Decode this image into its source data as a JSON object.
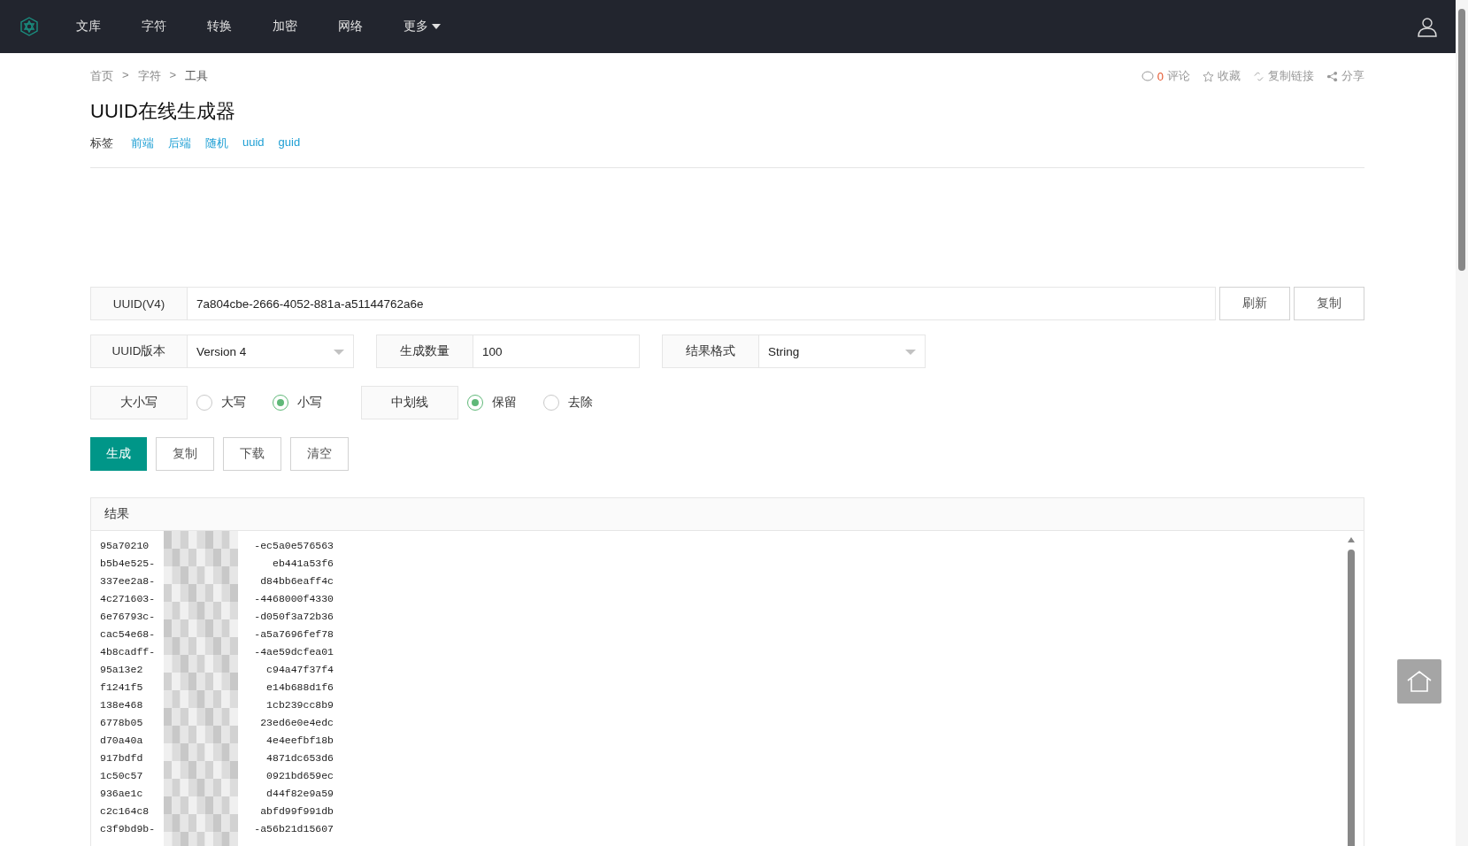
{
  "nav": {
    "items": [
      "文库",
      "字符",
      "转换",
      "加密",
      "网络"
    ],
    "more": "更多"
  },
  "breadcrumb": [
    "首页",
    "字符",
    "工具"
  ],
  "breadcrumb_separator": ">",
  "title": "UUID在线生成器",
  "tags": {
    "label": "标签",
    "items": [
      "前端",
      "后端",
      "随机",
      "uuid",
      "guid"
    ]
  },
  "actions": {
    "comment_count": "0",
    "comment": "评论",
    "favorite": "收藏",
    "copy_link": "复制链接",
    "share": "分享"
  },
  "uuid_row": {
    "label": "UUID(V4)",
    "value": "7a804cbe-2666-4052-881a-a51144762a6e",
    "buttons": [
      "刷新",
      "复制"
    ]
  },
  "settings": [
    {
      "label": "UUID版本",
      "value": "Version 4",
      "kind": "select"
    },
    {
      "label": "生成数量",
      "value": "100",
      "kind": "input"
    },
    {
      "label": "结果格式",
      "value": "String",
      "kind": "select"
    }
  ],
  "radio_groups": [
    {
      "label": "大小写",
      "options": [
        {
          "label": "大写",
          "selected": false
        },
        {
          "label": "小写",
          "selected": true
        }
      ]
    },
    {
      "label": "中划线",
      "options": [
        {
          "label": "保留",
          "selected": true
        },
        {
          "label": "去除",
          "selected": false
        }
      ]
    }
  ],
  "buttons": [
    {
      "label": "生成",
      "kind": "primary"
    },
    {
      "label": "复制",
      "kind": "default"
    },
    {
      "label": "下载",
      "kind": "default"
    },
    {
      "label": "清空",
      "kind": "default"
    }
  ],
  "results": {
    "title": "结果",
    "lines": [
      {
        "head": "95a70210",
        "tail": "-ec5a0e576563"
      },
      {
        "head": "b5b4e525-",
        "tail": "eb441a53f6"
      },
      {
        "head": "337ee2a8-",
        "tail": "d84bb6eaff4c"
      },
      {
        "head": "4c271603-",
        "tail": "-4468000f4330"
      },
      {
        "head": "6e76793c-",
        "tail": "-d050f3a72b36"
      },
      {
        "head": "cac54e68-",
        "tail": "-a5a7696fef78"
      },
      {
        "head": "4b8cadff-",
        "tail": "-4ae59dcfea01"
      },
      {
        "head": "95a13e2",
        "tail": "c94a47f37f4"
      },
      {
        "head": "f1241f5",
        "tail": "e14b688d1f6"
      },
      {
        "head": "138e468",
        "tail": "1cb239cc8b9"
      },
      {
        "head": "6778b05",
        "tail": "23ed6e0e4edc"
      },
      {
        "head": "d70a40a",
        "tail": "4e4eefbf18b"
      },
      {
        "head": "917bdfd",
        "tail": "4871dc653d6"
      },
      {
        "head": "1c50c57",
        "tail": "0921bd659ec"
      },
      {
        "head": "936ae1c",
        "tail": "d44f82e9a59"
      },
      {
        "head": "c2c164c8",
        "tail": "abfd99f991db"
      },
      {
        "head": "c3f9bd9b-",
        "tail": "-a56b21d15607"
      }
    ]
  }
}
